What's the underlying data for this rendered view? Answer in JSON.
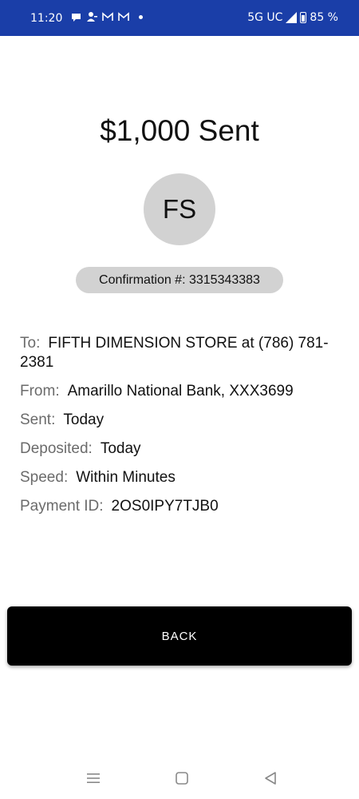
{
  "status_bar": {
    "time": "11:20",
    "network": "5G UC",
    "battery": "85 %",
    "background_color": "#1a3ea8",
    "notification_icons": [
      "chat-bubble-icon",
      "person-plus-icon",
      "gmail-icon",
      "gmail-icon",
      "dot-icon"
    ]
  },
  "main": {
    "title": "$1,000 Sent",
    "avatar_initials": "FS",
    "confirmation": "Confirmation #: 3315343383"
  },
  "details": [
    {
      "label": "To:",
      "value": "FIFTH DIMENSION STORE at (786) 781-2381"
    },
    {
      "label": "From:",
      "value": "Amarillo National Bank, XXX3699"
    },
    {
      "label": "Sent:",
      "value": "Today"
    },
    {
      "label": "Deposited:",
      "value": "Today"
    },
    {
      "label": "Speed:",
      "value": "Within Minutes"
    },
    {
      "label": "Payment ID:",
      "value": "2OS0IPY7TJB0"
    }
  ],
  "actions": {
    "back_label": "BACK"
  },
  "nav_bar": {
    "icons": [
      "recent-apps-icon",
      "home-icon",
      "back-icon"
    ]
  }
}
